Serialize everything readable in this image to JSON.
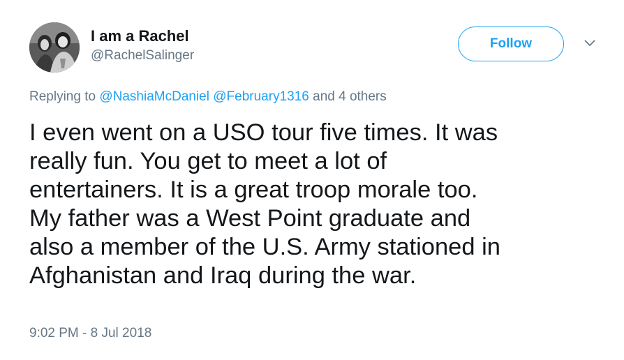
{
  "author": {
    "display_name": "I am a Rachel",
    "handle": "@RachelSalinger"
  },
  "actions": {
    "follow_label": "Follow",
    "more_icon": "chevron-down-icon"
  },
  "reply_context": {
    "prefix": "Replying to",
    "mentions": [
      "@NashiaMcDaniel",
      "@February1316"
    ],
    "suffix": "and 4 others"
  },
  "tweet": {
    "lines": [
      "I even went on a USO tour five times. It was",
      "really fun. You get to meet a lot of",
      "entertainers. It is a great troop morale too.",
      "My father was a West Point graduate and",
      "also a member of the U.S. Army stationed in",
      "Afghanistan and Iraq during the war."
    ],
    "timestamp": "9:02 PM - 8 Jul 2018"
  },
  "colors": {
    "accent": "#1da1f2",
    "text": "#14171a",
    "secondary": "#657786"
  }
}
